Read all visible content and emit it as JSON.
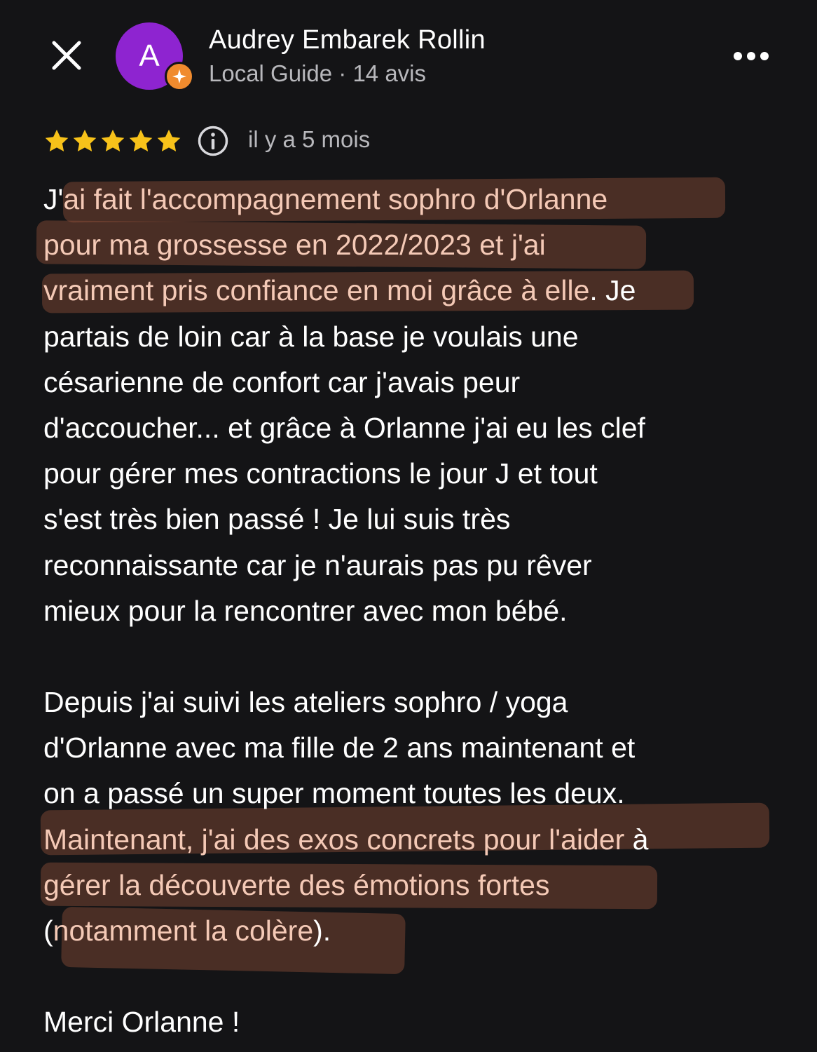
{
  "header": {
    "avatar_letter": "A",
    "author_name": "Audrey Embarek Rollin",
    "author_meta": "Local Guide · 14 avis",
    "close_icon": "close-icon",
    "more_icon": "more-options-icon",
    "badge_icon": "local-guide-star-icon"
  },
  "rating": {
    "stars": 5,
    "max_stars": 5,
    "time": "il y a 5 mois"
  },
  "review": {
    "lines": [
      {
        "pre": "J'",
        "hl": "ai fait l'accompagnement sophro d'Orlanne",
        "post": ""
      },
      {
        "pre": "",
        "hl": "pour ma grossesse en 2022/2023 et j'ai",
        "post": ""
      },
      {
        "pre": "",
        "hl": "vraiment pris confiance en moi grâce à elle",
        "post": ". Je"
      },
      {
        "pre": "partais de loin car à la base je voulais une",
        "hl": "",
        "post": ""
      },
      {
        "pre": "césarienne de confort car j'avais peur",
        "hl": "",
        "post": ""
      },
      {
        "pre": "d'accoucher... et grâce à Orlanne j'ai eu les clef",
        "hl": "",
        "post": ""
      },
      {
        "pre": "pour gérer mes contractions le jour J et tout",
        "hl": "",
        "post": ""
      },
      {
        "pre": "s'est très bien passé ! Je lui suis très",
        "hl": "",
        "post": ""
      },
      {
        "pre": "reconnaissante car je n'aurais pas pu rêver",
        "hl": "",
        "post": ""
      },
      {
        "pre": "mieux pour la rencontrer avec mon bébé.",
        "hl": "",
        "post": ""
      },
      {
        "pre": "",
        "hl": "",
        "post": ""
      },
      {
        "pre": "Depuis j'ai suivi les ateliers sophro / yoga",
        "hl": "",
        "post": ""
      },
      {
        "pre": "d'Orlanne avec ma fille de 2 ans maintenant et",
        "hl": "",
        "post": ""
      },
      {
        "pre": "on a passé un super moment toutes les deux.",
        "hl": "",
        "post": ""
      },
      {
        "pre": "",
        "hl": "Maintenant, j'ai des exos concrets pour l'aider",
        "post": " à"
      },
      {
        "pre": "",
        "hl": "gérer la découverte des émotions fortes",
        "post": ""
      },
      {
        "pre": "(",
        "hl": "notamment la colère",
        "post": ")."
      },
      {
        "pre": "",
        "hl": "",
        "post": ""
      },
      {
        "pre": "Merci Orlanne !",
        "hl": "",
        "post": ""
      }
    ]
  },
  "colors": {
    "background": "#141416",
    "text": "#ffffff",
    "secondary_text": "#b8b8bc",
    "star": "#f7c21a",
    "avatar": "#8e24d0",
    "badge": "#f08b2e",
    "highlight_text": "#f4c9b6"
  }
}
